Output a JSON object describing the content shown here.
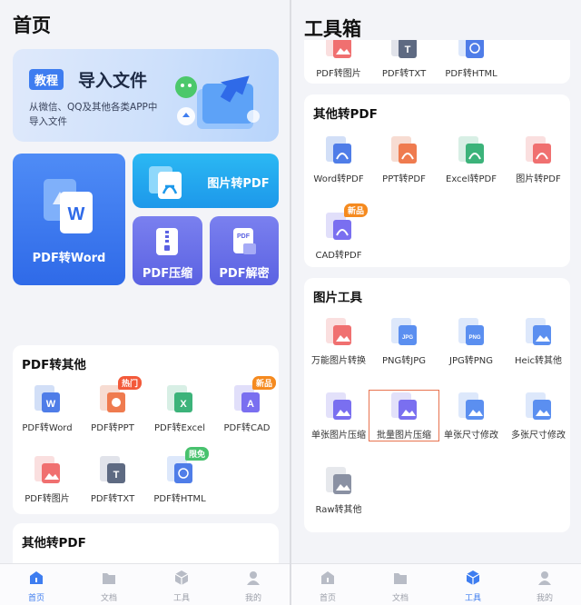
{
  "left": {
    "title": "首页",
    "banner": {
      "tag": "教程",
      "heading": "导入文件",
      "subtitle": "从微信、QQ及其他各类APP中导入文件"
    },
    "cards": {
      "pdf_to_word": "PDF转Word",
      "img_to_pdf": "图片转PDF",
      "pdf_compress": "PDF压缩",
      "pdf_decrypt": "PDF解密"
    },
    "pdf_to_other": {
      "title": "PDF转其他",
      "items": [
        {
          "label": "PDF转Word",
          "icon": "pdf-to-word-icon"
        },
        {
          "label": "PDF转PPT",
          "icon": "pdf-to-ppt-icon",
          "badge": "热门"
        },
        {
          "label": "PDF转Excel",
          "icon": "pdf-to-excel-icon"
        },
        {
          "label": "PDF转CAD",
          "icon": "pdf-to-cad-icon",
          "badge": "新品"
        },
        {
          "label": "PDF转图片",
          "icon": "pdf-to-image-icon"
        },
        {
          "label": "PDF转TXT",
          "icon": "pdf-to-txt-icon"
        },
        {
          "label": "PDF转HTML",
          "icon": "pdf-to-html-icon",
          "badge": "限免"
        }
      ]
    },
    "other_to_pdf_title": "其他转PDF"
  },
  "right": {
    "title": "工具箱",
    "top_items": [
      "PDF转图片",
      "PDF转TXT",
      "PDF转HTML"
    ],
    "other_to_pdf": {
      "title": "其他转PDF",
      "items": [
        "Word转PDF",
        "PPT转PDF",
        "Excel转PDF",
        "图片转PDF",
        "CAD转PDF"
      ],
      "cad_badge": "新品"
    },
    "image_tools": {
      "title": "图片工具",
      "items": [
        "万能图片转换",
        "PNG转JPG",
        "JPG转PNG",
        "Heic转其他",
        "单张图片压缩",
        "批量图片压缩",
        "单张尺寸修改",
        "多张尺寸修改",
        "Raw转其他"
      ],
      "selected": "批量图片压缩"
    }
  },
  "nav": {
    "items": [
      "首页",
      "文档",
      "工具",
      "我的"
    ],
    "left_active": "首页",
    "right_active": "工具"
  },
  "colors": {
    "accent": "#3e7df0",
    "hot": "#f35a3a",
    "new": "#f58a1f",
    "free": "#48c26e"
  }
}
